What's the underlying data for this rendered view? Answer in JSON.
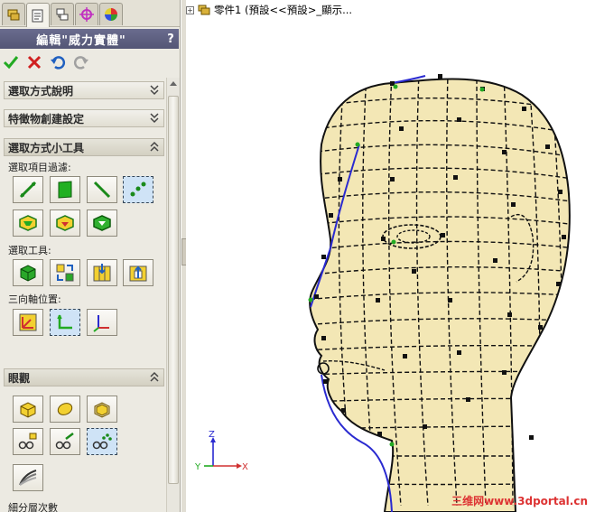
{
  "panel": {
    "tabs": [
      "feature-manager-tab",
      "property-manager-tab",
      "configuration-manager-tab",
      "dimxpert-tab",
      "appearance-tab"
    ],
    "title": "編輯\"威力實體\"",
    "help": "?",
    "actions": {
      "ok": "ok-icon",
      "cancel": "cancel-icon",
      "undo": "undo-icon",
      "redo": "redo-icon"
    },
    "groups": {
      "selection_help": "選取方式說明",
      "feature_creation": "特徵物創建設定",
      "selection_tools_group": "選取方式小工具",
      "view": "眼觀"
    },
    "labels": {
      "filter": "選取項目過濾:",
      "tools": "選取工具:",
      "triad": "三向軸位置:",
      "subdivision": "細分層次數"
    }
  },
  "viewport": {
    "tree_text": "零件1 (預設<<預設>_顯示...",
    "axes": {
      "z": "Z",
      "y": "Y",
      "x": "X"
    },
    "watermark": "三维网www.3dportal.cn"
  },
  "colors": {
    "title_bar": "#5c5e7e",
    "model_face": "#f3e7b5",
    "mesh_edge": "#111111",
    "accent_green": "#22aa22",
    "accent_blue": "#2a2ad0"
  }
}
